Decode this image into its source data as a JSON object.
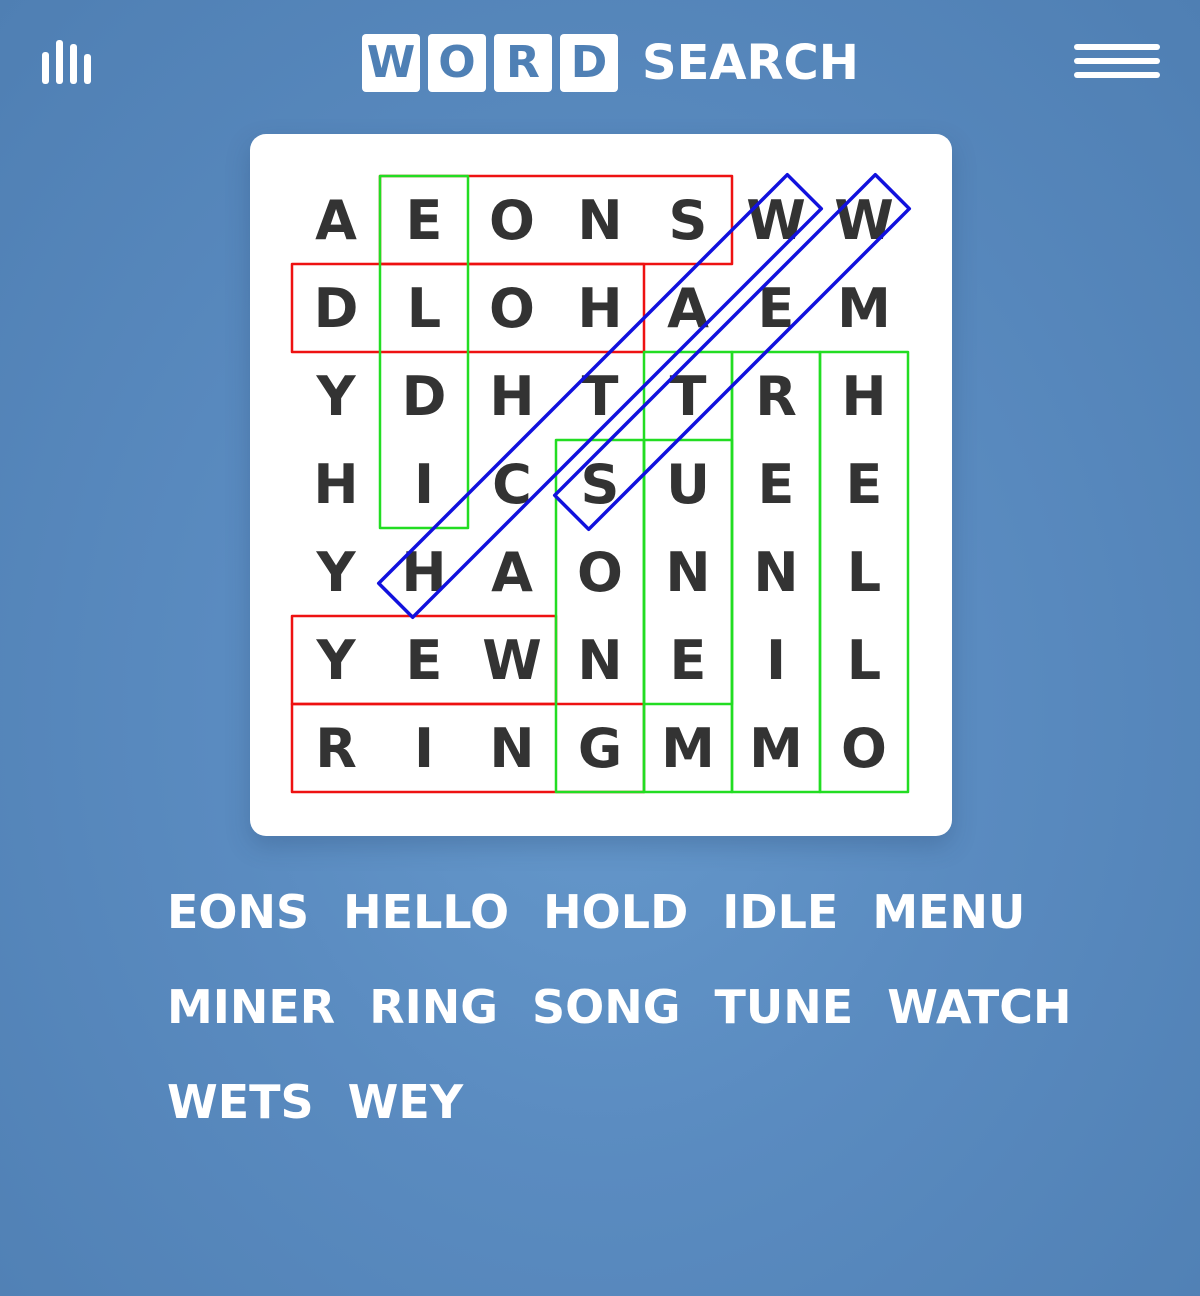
{
  "header": {
    "logo_letters": [
      "W",
      "O",
      "R",
      "D"
    ],
    "logo_suffix": "SEARCH",
    "stats_icon": "bar-chart-icon",
    "menu_icon": "hamburger-menu-icon"
  },
  "grid": {
    "rows": [
      [
        "A",
        "E",
        "O",
        "N",
        "S",
        "W",
        "W"
      ],
      [
        "D",
        "L",
        "O",
        "H",
        "A",
        "E",
        "M"
      ],
      [
        "Y",
        "D",
        "H",
        "T",
        "T",
        "R",
        "H"
      ],
      [
        "H",
        "I",
        "C",
        "S",
        "U",
        "E",
        "E"
      ],
      [
        "Y",
        "H",
        "A",
        "O",
        "N",
        "N",
        "L"
      ],
      [
        "Y",
        "E",
        "W",
        "N",
        "E",
        "I",
        "L"
      ],
      [
        "R",
        "I",
        "N",
        "G",
        "M",
        "M",
        "O"
      ]
    ]
  },
  "highlights": [
    {
      "color": "#ee1111",
      "from": [
        0,
        1
      ],
      "to": [
        0,
        4
      ]
    },
    {
      "color": "#ee1111",
      "from": [
        1,
        0
      ],
      "to": [
        1,
        3
      ]
    },
    {
      "color": "#ee1111",
      "from": [
        5,
        0
      ],
      "to": [
        5,
        2
      ]
    },
    {
      "color": "#ee1111",
      "from": [
        6,
        0
      ],
      "to": [
        6,
        3
      ]
    },
    {
      "color": "#22dd22",
      "from": [
        0,
        1
      ],
      "to": [
        3,
        1
      ]
    },
    {
      "color": "#22dd22",
      "from": [
        2,
        4
      ],
      "to": [
        5,
        4
      ]
    },
    {
      "color": "#22dd22",
      "from": [
        3,
        3
      ],
      "to": [
        6,
        3
      ]
    },
    {
      "color": "#22dd22",
      "from": [
        3,
        4
      ],
      "to": [
        6,
        4
      ]
    },
    {
      "color": "#22dd22",
      "from": [
        2,
        5
      ],
      "to": [
        6,
        5
      ]
    },
    {
      "color": "#22dd22",
      "from": [
        2,
        6
      ],
      "to": [
        6,
        6
      ]
    },
    {
      "color": "#1111dd",
      "from": [
        0,
        5
      ],
      "to": [
        4,
        1
      ]
    },
    {
      "color": "#1111dd",
      "from": [
        0,
        6
      ],
      "to": [
        3,
        3
      ]
    }
  ],
  "words": [
    [
      "EONS",
      "HELLO",
      "HOLD",
      "IDLE",
      "MENU"
    ],
    [
      "MINER",
      "RING",
      "SONG",
      "TUNE",
      "WATCH"
    ],
    [
      "WETS",
      "WEY"
    ]
  ]
}
